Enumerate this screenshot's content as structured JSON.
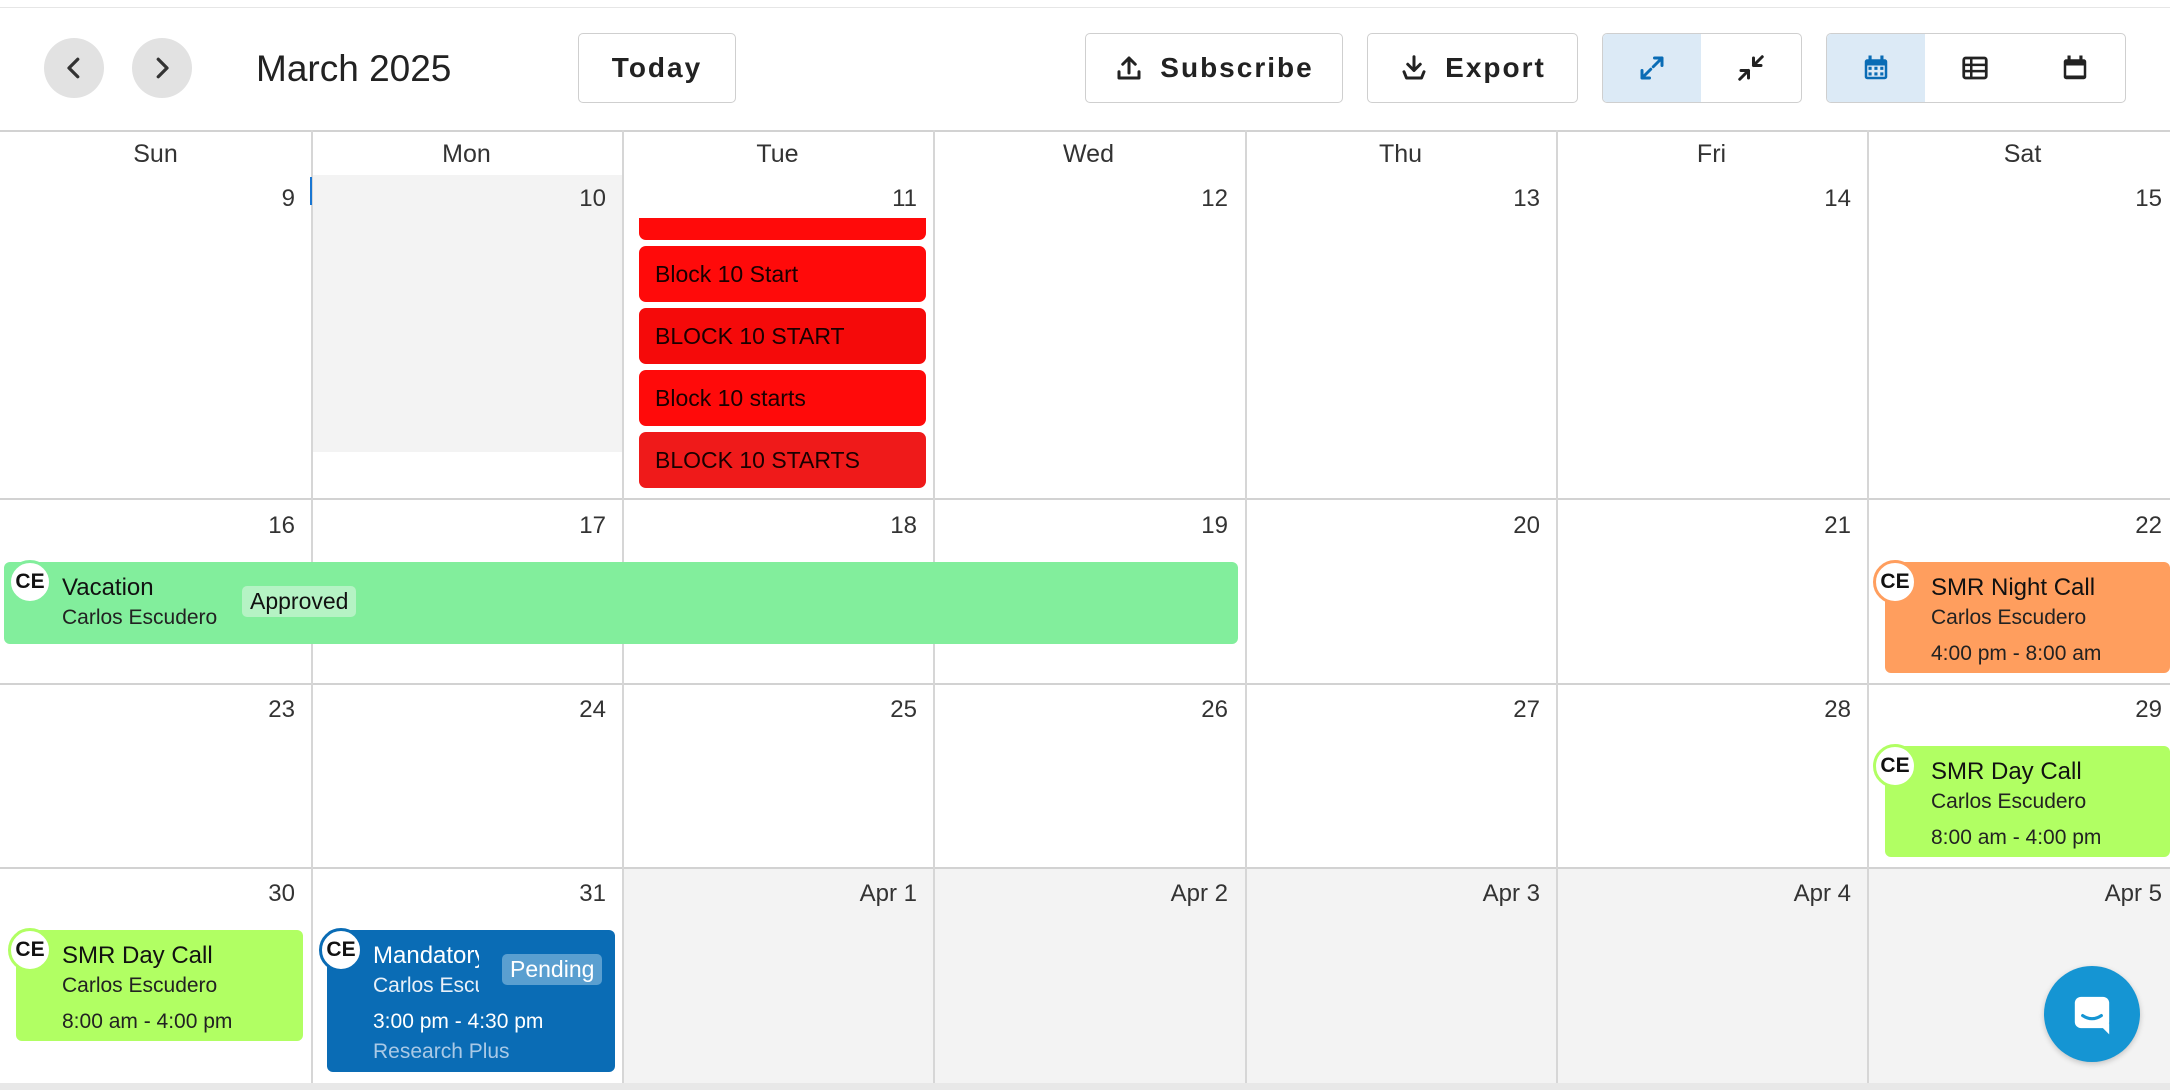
{
  "header": {
    "month_title": "March 2025",
    "today_label": "Today",
    "subscribe_label": "Subscribe",
    "export_label": "Export"
  },
  "icons": {
    "prev": "chevron-left-icon",
    "next": "chevron-right-icon",
    "subscribe": "upload-icon",
    "export": "download-icon",
    "expand": "expand-icon",
    "collapse": "collapse-icon",
    "month_view": "calendar-month-icon",
    "list_view": "list-view-icon",
    "day_view": "calendar-day-icon",
    "chat": "chat-icon"
  },
  "colors": {
    "accent": "#1976d2",
    "block_red": "#ff0a0a",
    "vacation_green": "#82ee9c",
    "night_call_orange": "#ff9e5e",
    "day_call_green": "#b1ff63",
    "pending_blue": "#0a6cb5"
  },
  "weekdays": [
    "Sun",
    "Mon",
    "Tue",
    "Wed",
    "Thu",
    "Fri",
    "Sat"
  ],
  "weeks": [
    [
      "9",
      "10",
      "11",
      "12",
      "13",
      "14",
      "15"
    ],
    [
      "16",
      "17",
      "18",
      "19",
      "20",
      "21",
      "22"
    ],
    [
      "23",
      "24",
      "25",
      "26",
      "27",
      "28",
      "29"
    ],
    [
      "30",
      "31",
      "Apr 1",
      "Apr 2",
      "Apr 3",
      "Apr 4",
      "Apr 5"
    ]
  ],
  "events": {
    "tue_11": [
      "Block 10 Start",
      "BLOCK 10 START",
      "Block 10 starts",
      "BLOCK 10 STARTS"
    ],
    "vacation": {
      "initials": "CE",
      "title": "Vacation",
      "person": "Carlos Escudero",
      "status": "Approved"
    },
    "night_call": {
      "initials": "CE",
      "title": "SMR Night Call",
      "person": "Carlos Escudero",
      "time": "4:00 pm - 8:00 am"
    },
    "day_call_29": {
      "initials": "CE",
      "title": "SMR Day Call",
      "person": "Carlos Escudero",
      "time": "8:00 am - 4:00 pm"
    },
    "day_call_30": {
      "initials": "CE",
      "title": "SMR Day Call",
      "person": "Carlos Escudero",
      "time": "8:00 am - 4:00 pm"
    },
    "mandatory": {
      "initials": "CE",
      "title": "Mandatory",
      "person": "Carlos Escudero",
      "status": "Pending",
      "time": "3:00 pm - 4:30 pm",
      "location": "Research Plus"
    }
  }
}
